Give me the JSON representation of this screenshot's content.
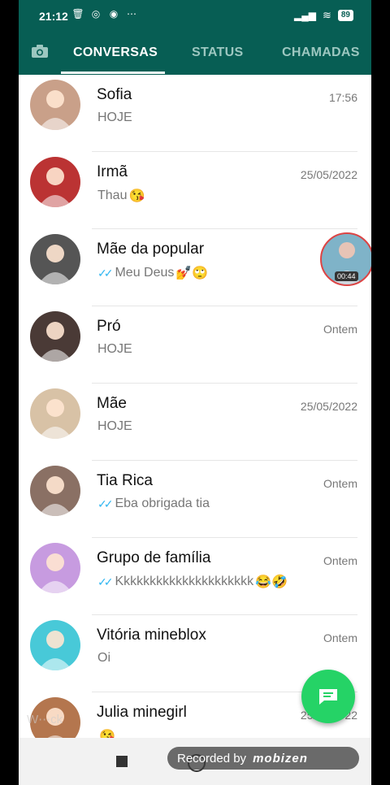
{
  "status_bar": {
    "time": "21:12",
    "battery": "89",
    "icons": [
      "trash-icon",
      "whatsapp-icon",
      "messenger-icon",
      "more-dots-icon"
    ]
  },
  "tabs": [
    {
      "label": "CONVERSAS",
      "active": true
    },
    {
      "label": "STATUS",
      "active": false
    },
    {
      "label": "CHAMADAS",
      "active": false
    }
  ],
  "chats": [
    {
      "name": "Sofia",
      "date": "17:56",
      "message": "HOJE",
      "ticks": false,
      "emoji": "",
      "avatar_color": "#c9a089"
    },
    {
      "name": "Irmã",
      "date": "25/05/2022",
      "message": "Thau",
      "ticks": false,
      "emoji": "😘",
      "avatar_color": "#b33"
    },
    {
      "name": "Mãe da popular",
      "date": "",
      "message": "Meu Deus",
      "ticks": true,
      "emoji": "💅🙄",
      "avatar_color": "#555"
    },
    {
      "name": "Pró",
      "date": "Ontem",
      "message": "HOJE",
      "ticks": false,
      "emoji": "",
      "avatar_color": "#4a3a36"
    },
    {
      "name": "Mãe",
      "date": "25/05/2022",
      "message": "HOJE",
      "ticks": false,
      "emoji": "",
      "avatar_color": "#d8c2a6"
    },
    {
      "name": "Tia Rica",
      "date": "Ontem",
      "message": "Eba obrigada tia",
      "ticks": true,
      "emoji": "",
      "avatar_color": "#8a7064"
    },
    {
      "name": "Grupo de família",
      "date": "Ontem",
      "message": "Kkkkkkkkkkkkkkkkkkkkk",
      "ticks": true,
      "emoji": "😂🤣",
      "avatar_color": "#c79be0"
    },
    {
      "name": "Vitória mineblox",
      "date": "Ontem",
      "message": "Oi",
      "ticks": false,
      "emoji": "",
      "avatar_color": "#48c9d8"
    },
    {
      "name": "Julia minegirl",
      "date": "25/05/2022",
      "message": "",
      "ticks": false,
      "emoji": "😘",
      "avatar_color": "#b4764e"
    }
  ],
  "bubble_timer": "00:44",
  "recorded_label": "Recorded by",
  "recorded_brand": "mobizen",
  "colors": {
    "header": "#075e54",
    "accent": "#25d366",
    "ticks": "#34b7f1"
  }
}
